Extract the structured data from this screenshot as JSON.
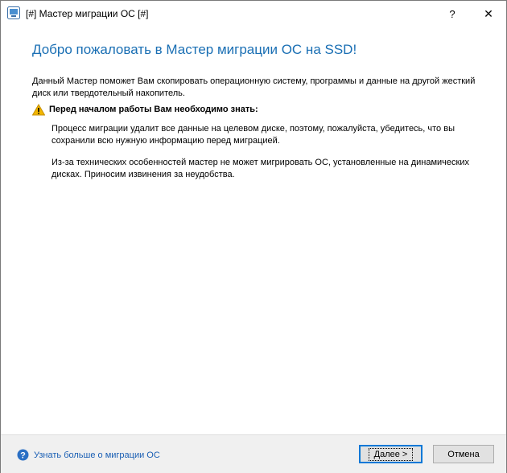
{
  "window": {
    "title": "[#] Мастер миграции ОС [#]",
    "help_label": "?",
    "close_label": "✕"
  },
  "content": {
    "heading": "Добро пожаловать в Мастер миграции ОС на SSD!",
    "intro": "Данный Мастер поможет Вам скопировать операционную систему, программы и данные на другой жесткий диск или твердотельный накопитель.",
    "warning_title": "Перед началом работы Вам необходимо знать:",
    "paragraph1": "Процесс миграции удалит все данные на целевом диске, поэтому, пожалуйста, убедитесь, что вы сохранили всю нужную информацию перед миграцией.",
    "paragraph2": "Из-за технических особенностей мастер не может мигрировать ОС, установленные на динамических дисках. Приносим извинения за неудобства."
  },
  "footer": {
    "learn_more_link": "Узнать больше о миграции ОС",
    "next_button": "Далее >",
    "cancel_button": "Отмена"
  },
  "colors": {
    "heading": "#1a6fb4",
    "link": "#1a5fb4",
    "warning": "#f2b600",
    "focus_border": "#0078d7"
  },
  "icons": {
    "app": "app-window-icon",
    "warning": "warning-triangle-icon",
    "help": "question-circle-icon"
  }
}
